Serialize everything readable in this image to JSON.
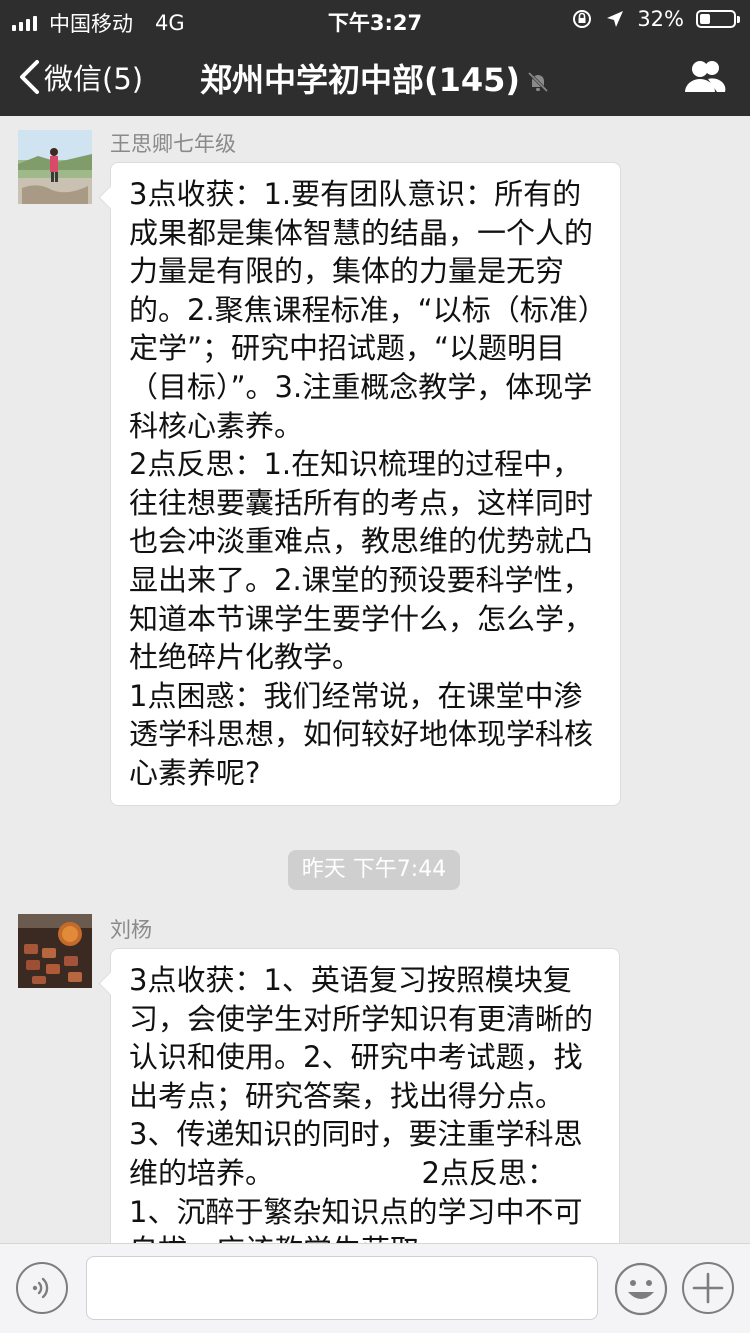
{
  "status": {
    "carrier": "中国移动",
    "network": "4G",
    "time": "下午3:27",
    "battery": "32%",
    "battery_level": 0.32
  },
  "nav": {
    "back_label": "微信(5)",
    "title": "郑州中学初中部(145)"
  },
  "messages": [
    {
      "sender": "王思卿七年级",
      "text": "3点收获：1.要有团队意识：所有的成果都是集体智慧的结晶，一个人的力量是有限的，集体的力量是无穷的。2.聚焦课程标准，“以标（标准）定学”；研究中招试题，“以题明目（目标）”。3.注重概念教学，体现学科核心素养。\n2点反思：1.在知识梳理的过程中，往往想要囊括所有的考点，这样同时也会冲淡重难点，教思维的优势就凸显出来了。2.课堂的预设要科学性，知道本节课学生要学什么，怎么学，杜绝碎片化教学。\n1点困惑：我们经常说，在课堂中渗透学科思想，如何较好地体现学科核心素养呢?"
    },
    {
      "sender": "刘杨",
      "text": "3点收获：1、英语复习按照模块复习，会使学生对所学知识有更清晰的认识和使用。2、研究中考试题，找出考点；研究答案，找出得分点。3、传递知识的同时，要注重学科思维的培养。                2点反思：1、沉醉于繁杂知识点的学习中不可自拔，应该教学生获取"
    }
  ],
  "timestamp": "昨天 下午7:44",
  "colors": {
    "nav_bg": "#2e2e2e",
    "chat_bg": "#ebebeb",
    "bubble_bg": "#ffffff",
    "timestamp_bg": "#cfcfcf"
  },
  "icons": {
    "back": "chevron-left-icon",
    "mute": "muted-bell-icon",
    "group": "group-members-icon",
    "voice": "voice-icon",
    "emoji": "emoji-icon",
    "plus": "plus-icon"
  }
}
